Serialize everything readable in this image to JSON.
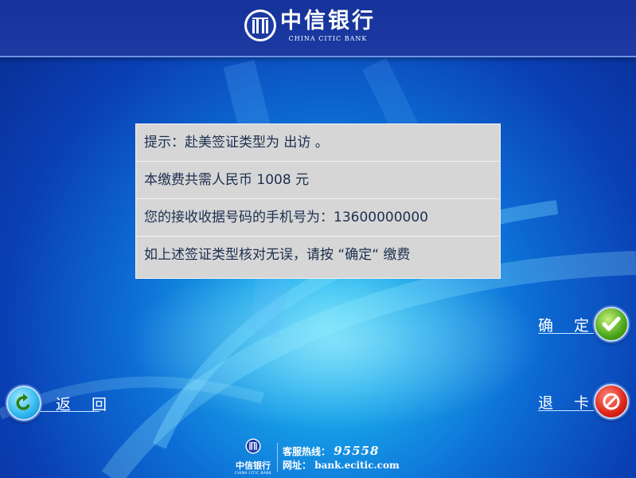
{
  "header": {
    "brand_cn": "中信银行",
    "brand_en": "CHINA CITIC BANK"
  },
  "info": {
    "rows": [
      "提示：赴美签证类型为 出访 。",
      "本缴费共需人民币 1008 元",
      "您的接收收据号码的手机号为：13600000000",
      "如上述签证类型核对无误，请按 “确定“ 缴费"
    ]
  },
  "buttons": {
    "confirm": "确 定",
    "exit_card": "退 卡",
    "back": "返 回"
  },
  "footer": {
    "brand_cn": "中信银行",
    "brand_en": "CHINA CITIC BANK",
    "hotline_label": "客服热线：",
    "hotline_number": "95558",
    "website_label": "网址：",
    "website": "bank.ecitic.com"
  },
  "colors": {
    "panel_bg": "#d6d6d6",
    "panel_text": "#1c2f4e",
    "confirm_green": "#4aa51a",
    "exit_red": "#dd2418",
    "back_blue": "#2cb6ee"
  }
}
